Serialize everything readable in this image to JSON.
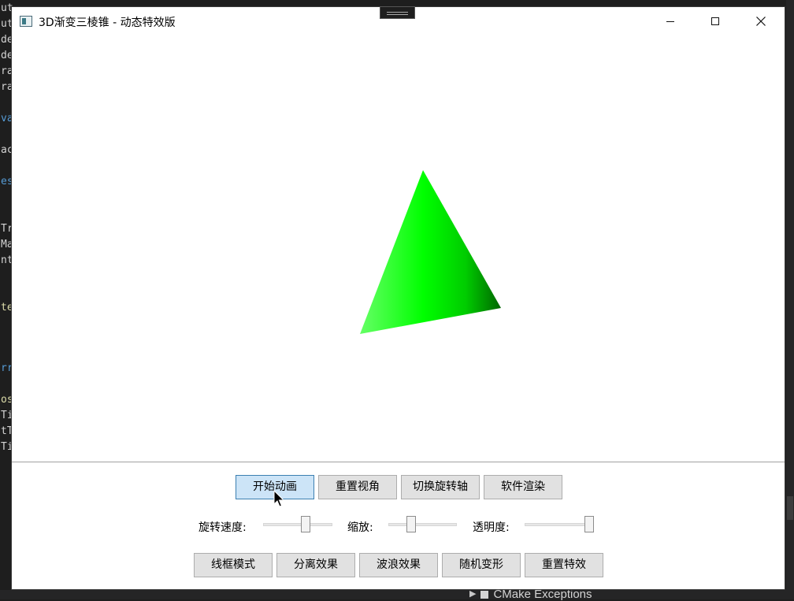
{
  "background_ide": {
    "code_fragments": [
      "ut",
      "ut",
      "de",
      "de",
      "ra",
      "ra",
      "va",
      "ac",
      "es",
      "Tr",
      "Ma",
      "nt",
      "te",
      "rr",
      "os",
      "Ti",
      "tT",
      "Ti"
    ],
    "exceptions_label": "CMake Exceptions"
  },
  "window": {
    "title": "3D渐变三棱锥 - 动态特效版",
    "controls": {
      "minimize_icon": "minimize-icon",
      "maximize_icon": "maximize-icon",
      "close_icon": "close-icon"
    }
  },
  "scene": {
    "shape": "triangular-pyramid",
    "colors": {
      "bright_green": "#00ff00",
      "mid_green": "#00cc00",
      "dark_green": "#006600",
      "light_green": "#66ff66"
    }
  },
  "toolbar_row1": [
    {
      "label": "开始动画",
      "active": true
    },
    {
      "label": "重置视角",
      "active": false
    },
    {
      "label": "切换旋转轴",
      "active": false
    },
    {
      "label": "软件渲染",
      "active": false
    }
  ],
  "sliders": {
    "rotation_speed": {
      "label": "旋转速度:",
      "value": 0.63
    },
    "zoom": {
      "label": "缩放:",
      "value": 0.3
    },
    "opacity": {
      "label": "透明度:",
      "value": 1.0
    }
  },
  "toolbar_row2": [
    {
      "label": "线框模式"
    },
    {
      "label": "分离效果"
    },
    {
      "label": "波浪效果"
    },
    {
      "label": "随机变形"
    },
    {
      "label": "重置特效"
    }
  ]
}
